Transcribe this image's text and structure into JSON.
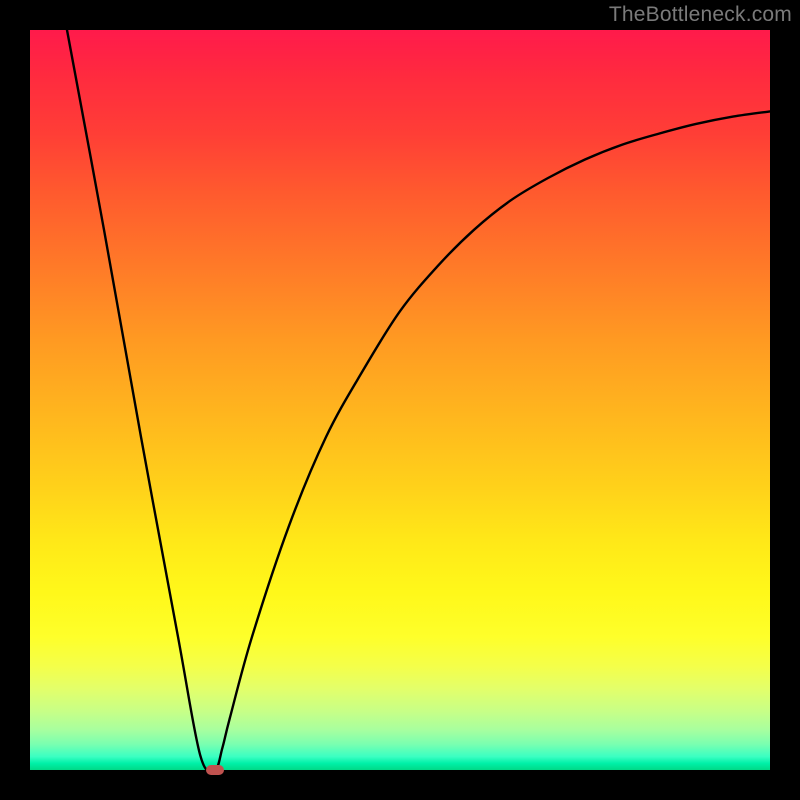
{
  "watermark": {
    "text": "TheBottleneck.com"
  },
  "colors": {
    "top": "#ff1a4b",
    "bottom": "#00d987",
    "curve": "#000000",
    "marker": "#c0524f",
    "frame": "#000000"
  },
  "chart_data": {
    "type": "line",
    "title": "",
    "xlabel": "",
    "ylabel": "",
    "xlim": [
      0,
      100
    ],
    "ylim": [
      0,
      100
    ],
    "grid": false,
    "legend": false,
    "series": [
      {
        "name": "bottleneck-curve",
        "x": [
          5,
          10,
          15,
          20,
          23,
          25,
          26,
          27,
          30,
          35,
          40,
          45,
          50,
          55,
          60,
          65,
          70,
          75,
          80,
          85,
          90,
          95,
          100
        ],
        "y": [
          100,
          73,
          45,
          18,
          2,
          0,
          3,
          7,
          18,
          33,
          45,
          54,
          62,
          68,
          73,
          77,
          80,
          82.5,
          84.5,
          86,
          87.3,
          88.3,
          89
        ]
      }
    ],
    "annotations": [
      {
        "name": "sweet-spot-marker",
        "x": 25,
        "y": 0,
        "shape": "rounded-pill",
        "color": "#c0524f"
      }
    ],
    "background_gradient": {
      "direction": "vertical",
      "stops": [
        {
          "pos": 0.0,
          "color": "#ff1a4b"
        },
        {
          "pos": 0.5,
          "color": "#ffb61e"
        },
        {
          "pos": 0.8,
          "color": "#feff2a"
        },
        {
          "pos": 1.0,
          "color": "#00d987"
        }
      ]
    }
  }
}
